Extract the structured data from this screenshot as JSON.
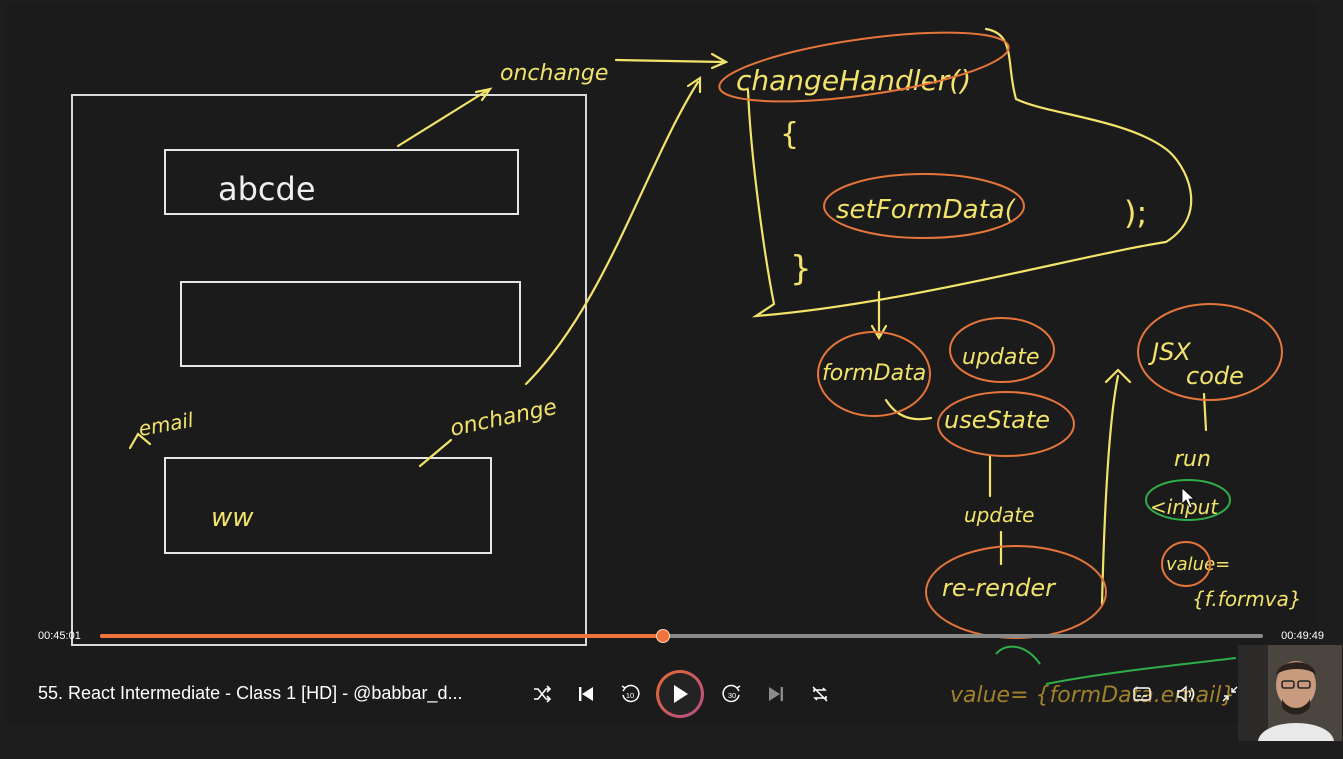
{
  "player": {
    "title": "55. React Intermediate - Class 1 [HD] - @babbar_d...",
    "current_time": "00:45:01",
    "total_time": "00:49:49",
    "progress": 0.4838,
    "accent_color": "#f0733b",
    "skip_back_seconds": "10",
    "skip_forward_seconds": "30"
  },
  "board": {
    "input_one_text": "abcde",
    "label_onchange_top": "onchange",
    "label_onchange_bottom": "onchange",
    "label_email": "email",
    "scribble_text": "ww",
    "handler_title": "changeHandler()",
    "brace_open": "{",
    "brace_close": "}",
    "set_call": "setFormData(",
    "set_call_end": ");",
    "node_formdata": "formData",
    "node_update": "update",
    "node_usestate": "useState",
    "label_update_mid": "update",
    "node_rerender": "re-render",
    "node_jsx_line1": "JSX",
    "node_jsx_line2": "code",
    "label_run": "run",
    "node_input": "<input",
    "node_value": "value=",
    "node_value_expr": "{f.formva}",
    "bottom_expr": "value= {formData.email}"
  },
  "icons": [
    "shuffle-icon",
    "previous-icon",
    "rewind-10-icon",
    "play-icon",
    "forward-30-icon",
    "next-icon",
    "repeat-off-icon",
    "captions-icon",
    "volume-icon",
    "minimize-icon",
    "mini-player-icon",
    "more-icon"
  ]
}
